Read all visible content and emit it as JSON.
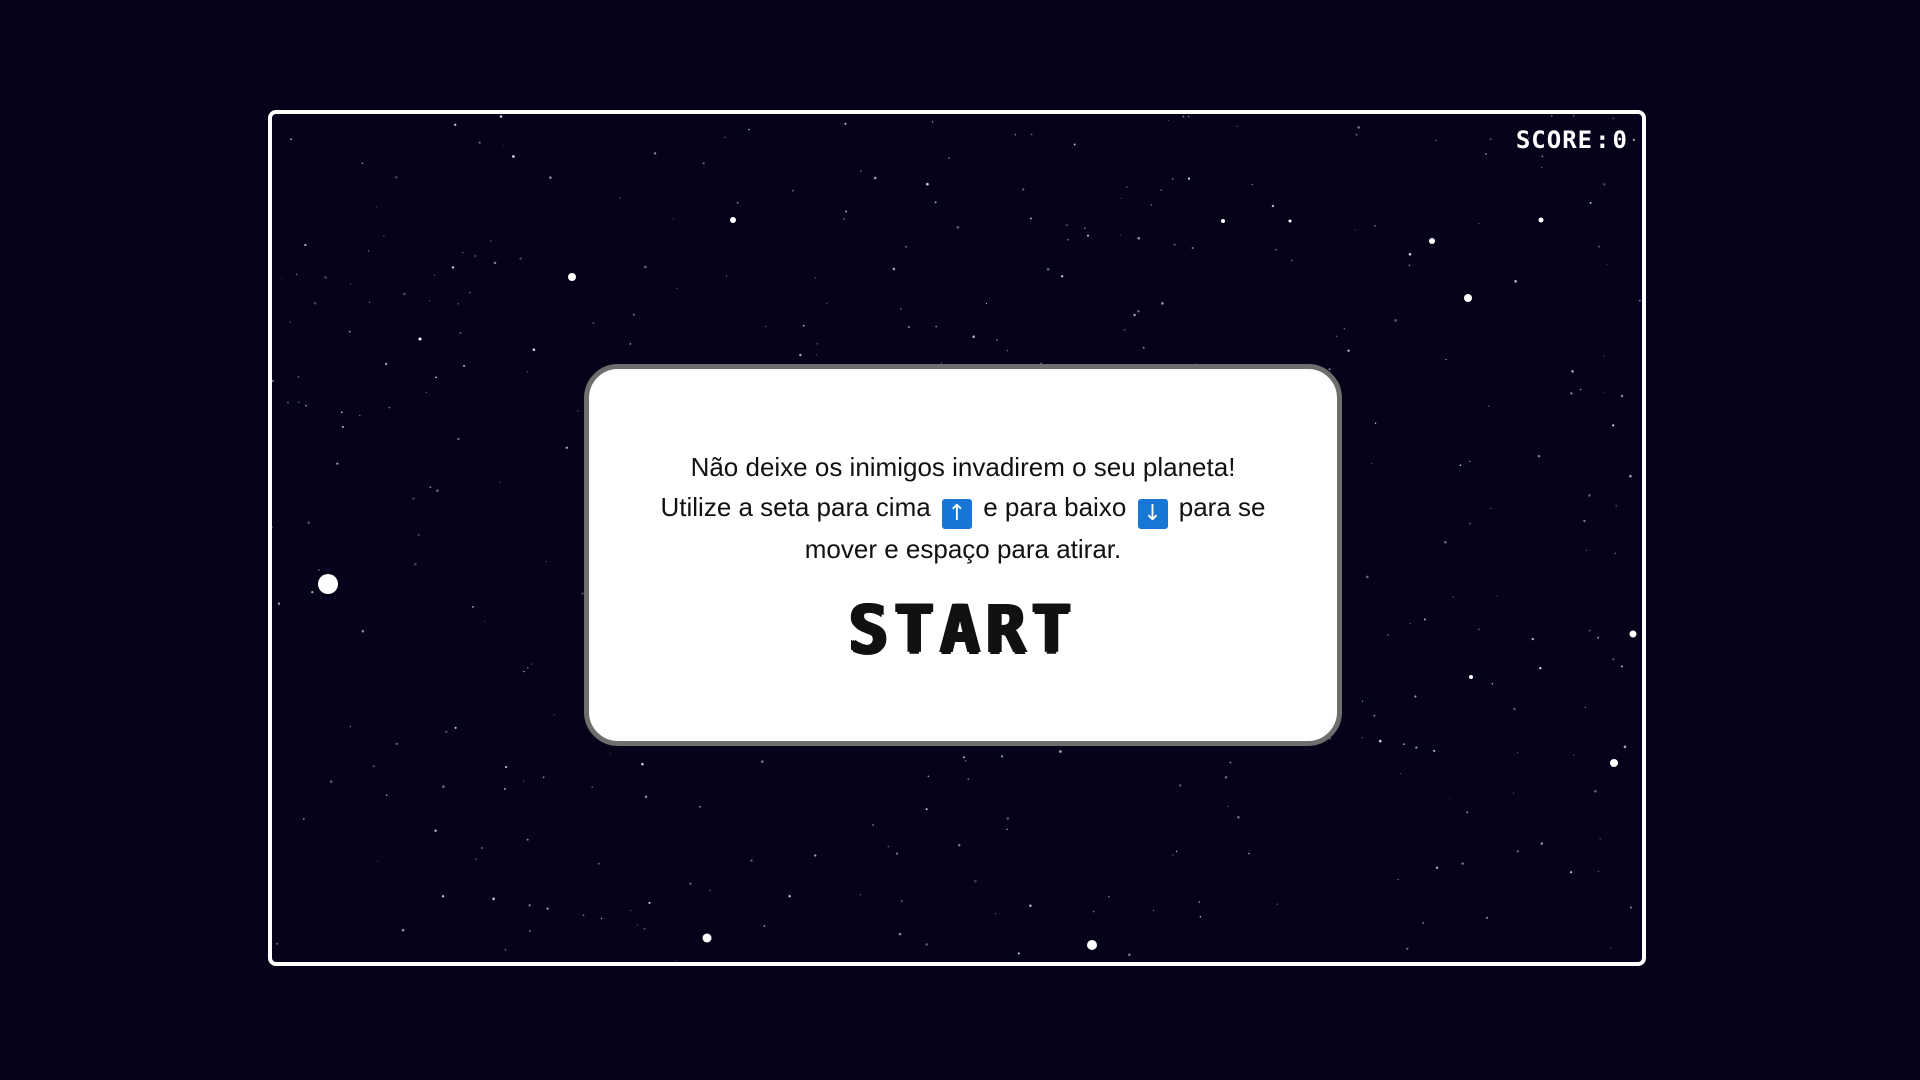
{
  "hud": {
    "score_label": "SCORE",
    "score_separator": ":",
    "score_value": "0"
  },
  "menu": {
    "line1": "Não deixe os inimigos invadirem o seu planeta!",
    "line2_before": "Utilize a seta para cima",
    "up_key": "↑",
    "line2_middle": "e para baixo",
    "down_key": "↓",
    "line2_after": "para se mover e espaço para atirar.",
    "start_label": "START"
  },
  "colors": {
    "background": "#05021a",
    "frame": "#ffffff",
    "panel": "#ffffff",
    "panel_border": "#6e6e6e",
    "key_icon": "#1677d4",
    "star": "#ffffff"
  },
  "icons": {
    "up_key": "arrow-up-key-icon",
    "down_key": "arrow-down-key-icon"
  }
}
